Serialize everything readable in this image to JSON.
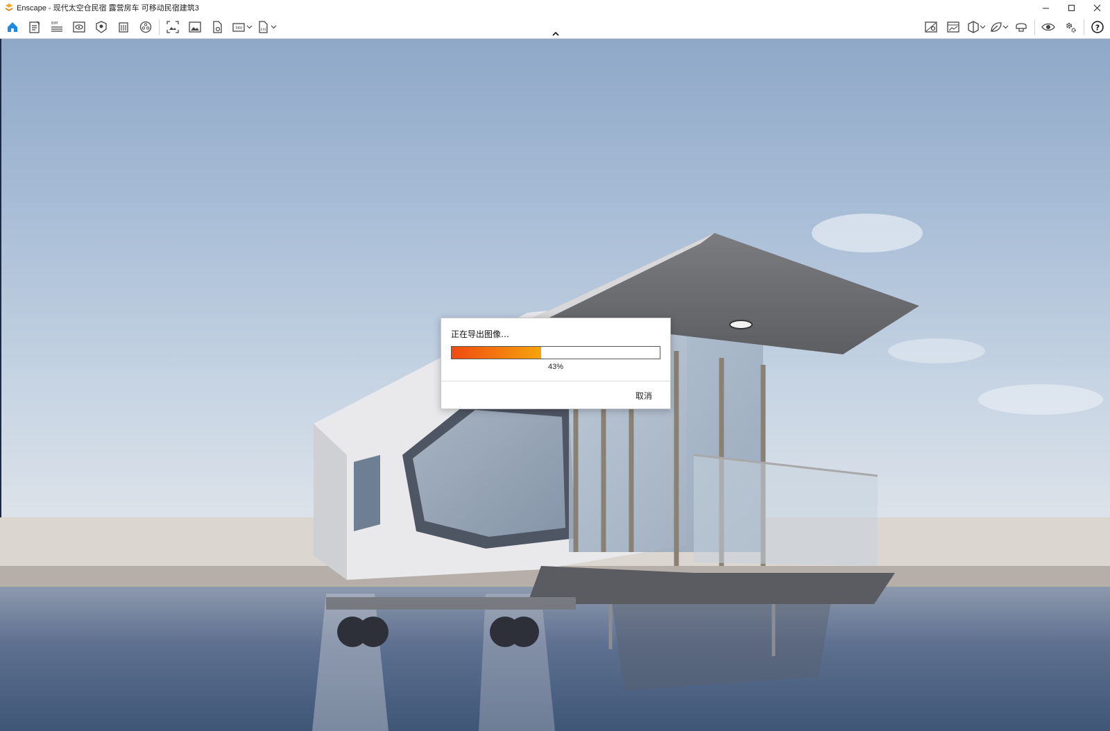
{
  "window": {
    "title": "Enscape - 现代太空仓民宿 露营房车 可移动民宿建筑3",
    "controls": [
      "minimize-icon",
      "maximize-icon",
      "close-icon"
    ]
  },
  "toolbar": {
    "left_icons": [
      "home-icon",
      "notes-icon",
      "bim-icon",
      "view-icon",
      "asset-library-icon",
      "building-icon",
      "materials-icon",
      "screenshot-icon",
      "image-icon",
      "export-file-icon",
      "panorama-360-icon",
      "exe-export-icon"
    ],
    "right_icons": [
      "map-icon",
      "gallery-icon",
      "cube-view-icon",
      "leaf-icon",
      "vr-headset-icon",
      "visual-settings-icon",
      "settings-icon",
      "help-icon"
    ],
    "accent_color": "#1e88e5"
  },
  "dialog": {
    "title": "正在导出图像…",
    "progress": 43,
    "progress_label": "43%",
    "cancel_label": "取消",
    "progress_colors": [
      "#f04a12",
      "#f5a30c"
    ]
  }
}
